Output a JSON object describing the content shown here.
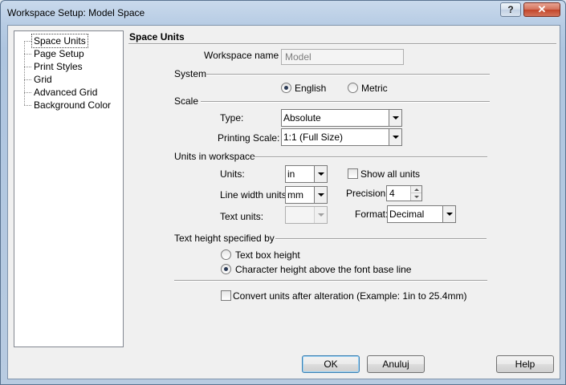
{
  "window": {
    "title": "Workspace Setup: Model Space",
    "help_label": "?",
    "close_label": "✕"
  },
  "tree": {
    "items": [
      {
        "label": "Space Units",
        "selected": true
      },
      {
        "label": "Page Setup"
      },
      {
        "label": "Print Styles"
      },
      {
        "label": "Grid"
      },
      {
        "label": "Advanced Grid"
      },
      {
        "label": "Background Color"
      }
    ]
  },
  "panel": {
    "title": "Space Units",
    "workspace_name_label": "Workspace name",
    "workspace_name_value": "Model",
    "system": {
      "group_label": "System",
      "english_label": "English",
      "metric_label": "Metric",
      "selected": "English"
    },
    "scale": {
      "group_label": "Scale",
      "type_label": "Type:",
      "type_value": "Absolute",
      "printing_scale_label": "Printing Scale:",
      "printing_scale_value": "1:1 (Full Size)"
    },
    "units": {
      "group_label": "Units in workspace",
      "units_label": "Units:",
      "units_value": "in",
      "line_width_label": "Line width units:",
      "line_width_value": "mm",
      "text_units_label": "Text units:",
      "text_units_value": "",
      "show_all_label": "Show all units",
      "show_all_checked": false,
      "precision_label": "Precision:",
      "precision_value": "4",
      "format_label": "Format:",
      "format_value": "Decimal"
    },
    "text_height": {
      "group_label": "Text height specified by",
      "option_box_label": "Text box height",
      "option_char_label": "Character height above the font base line",
      "selected": "Character height above the font base line"
    },
    "convert_label": "Convert units after alteration (Example: 1in to 25.4mm)",
    "convert_checked": false
  },
  "footer": {
    "ok_label": "OK",
    "cancel_label": "Anuluj",
    "help_label": "Help"
  }
}
